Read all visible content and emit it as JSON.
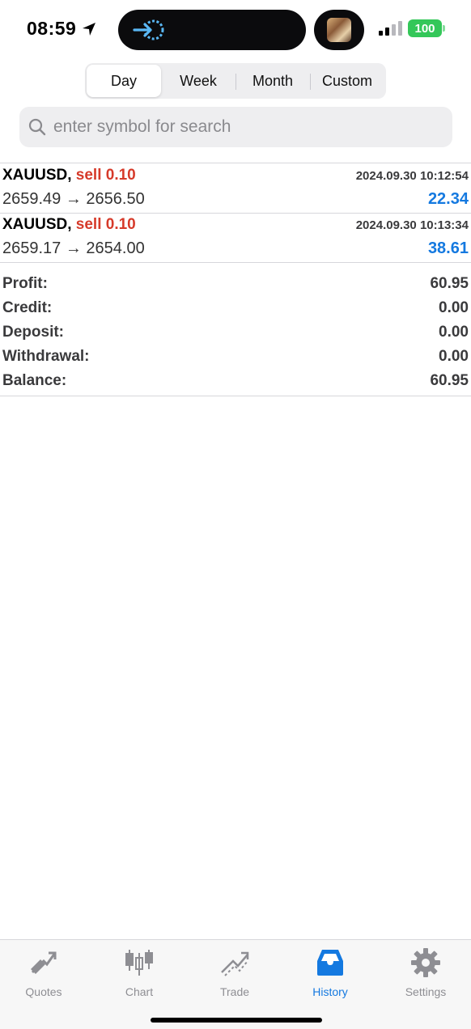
{
  "status_bar": {
    "time": "08:59",
    "battery": "100",
    "icons": [
      "location-arrow-icon",
      "live-activity-icon",
      "signal-icon",
      "battery-icon"
    ]
  },
  "period_tabs": [
    {
      "label": "Day",
      "selected": true
    },
    {
      "label": "Week",
      "selected": false
    },
    {
      "label": "Month",
      "selected": false
    },
    {
      "label": "Custom",
      "selected": false
    }
  ],
  "search": {
    "placeholder": "enter symbol for search",
    "value": ""
  },
  "deals": [
    {
      "symbol": "XAUUSD,",
      "side": "sell 0.10",
      "time": "2024.09.30 10:12:54",
      "prices": "2659.49 → 2656.50",
      "profit": "22.34"
    },
    {
      "symbol": "XAUUSD,",
      "side": "sell 0.10",
      "time": "2024.09.30 10:13:34",
      "prices": "2659.17 → 2654.00",
      "profit": "38.61"
    }
  ],
  "summary": [
    {
      "label": "Profit:",
      "value": "60.95"
    },
    {
      "label": "Credit:",
      "value": "0.00"
    },
    {
      "label": "Deposit:",
      "value": "0.00"
    },
    {
      "label": "Withdrawal:",
      "value": "0.00"
    },
    {
      "label": "Balance:",
      "value": "60.95"
    }
  ],
  "tab_bar": [
    {
      "label": "Quotes",
      "icon": "quotes-icon",
      "active": false
    },
    {
      "label": "Chart",
      "icon": "chart-candles-icon",
      "active": false
    },
    {
      "label": "Trade",
      "icon": "trade-icon",
      "active": false
    },
    {
      "label": "History",
      "icon": "history-inbox-icon",
      "active": true
    },
    {
      "label": "Settings",
      "icon": "gear-icon",
      "active": false
    }
  ],
  "colors": {
    "accent": "#1479e0",
    "sell": "#d63a2a",
    "battery": "#34c759"
  }
}
